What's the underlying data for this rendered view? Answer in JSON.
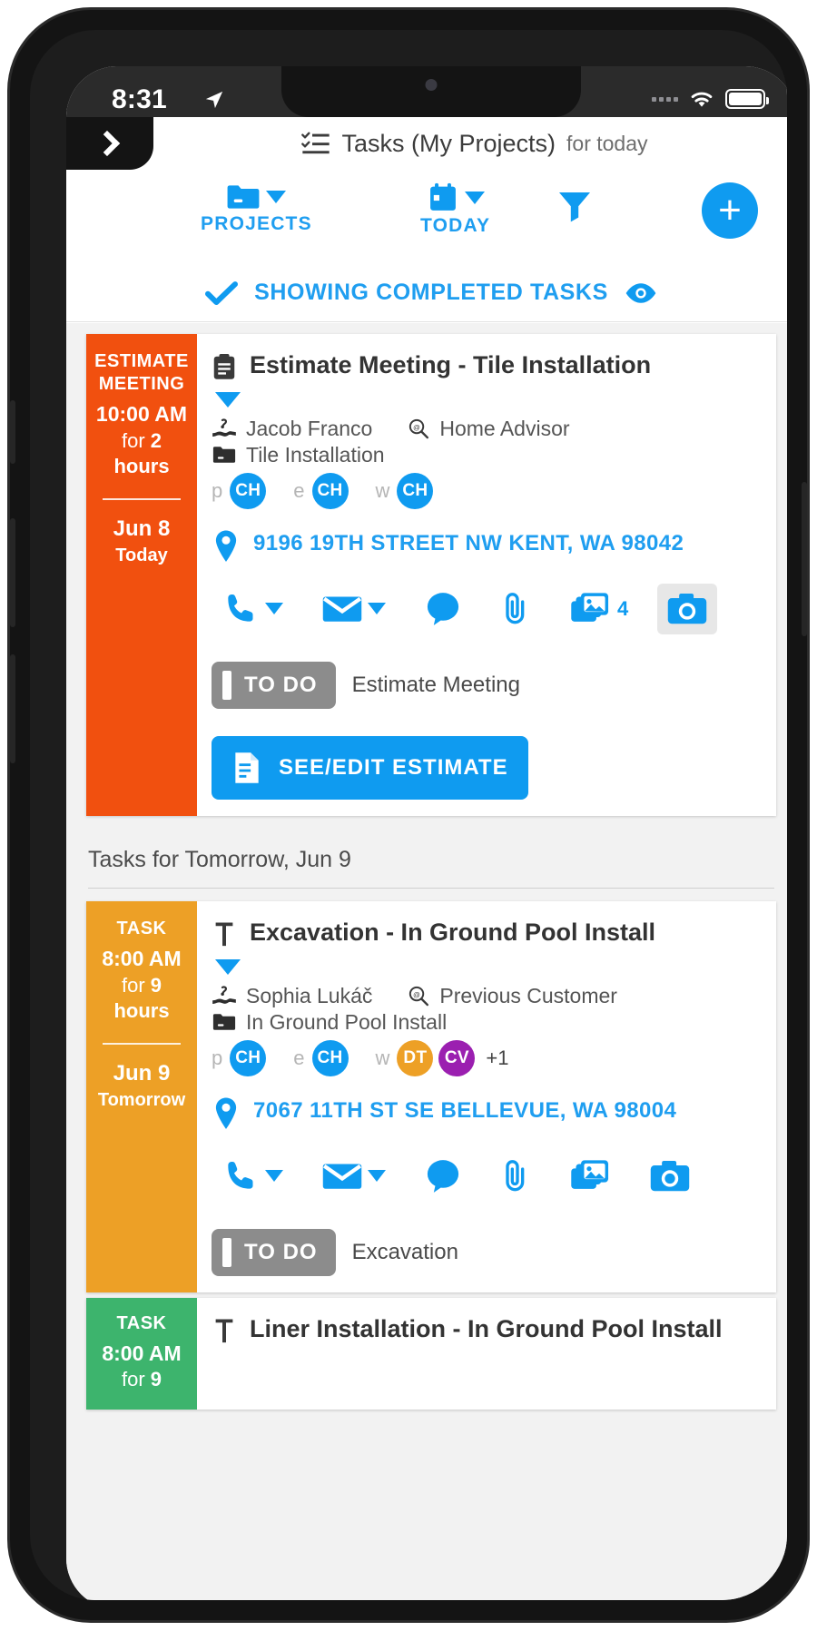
{
  "status_bar": {
    "time": "8:31",
    "location_icon": "location-arrow-icon",
    "wifi_icon": "wifi-icon",
    "battery_icon": "battery-icon"
  },
  "header": {
    "back_icon": "chevron-right-icon",
    "list_icon": "task-list-icon",
    "title": "Tasks (My Projects)",
    "subtitle": "for today"
  },
  "toolbar": {
    "projects": {
      "label": "PROJECTS",
      "icon": "folder-icon",
      "caret": "chevron-down-icon"
    },
    "today": {
      "label": "TODAY",
      "icon": "calendar-icon",
      "caret": "chevron-down-icon"
    },
    "filter": {
      "icon": "filter-icon"
    },
    "add": {
      "icon": "plus-icon",
      "label": "+"
    }
  },
  "completed_bar": {
    "check_icon": "check-icon",
    "label": "SHOWING COMPLETED TASKS",
    "eye_icon": "eye-icon"
  },
  "sections": [
    {
      "divider": null,
      "cards": [
        {
          "accent": "#f1500f",
          "kind": "ESTIMATE MEETING",
          "time": "10:00 AM",
          "duration_prefix": "for ",
          "duration_value": "2",
          "duration_unit": "hours",
          "date": "Jun 8",
          "relative": "Today",
          "title_icon": "clipboard-icon",
          "title": "Estimate Meeting - Tile Installation",
          "expand_icon": "chevron-down-icon",
          "contact_icon": "handshake-icon",
          "contact": "Jacob Franco",
          "source_icon": "magnifier-icon",
          "source": "Home Advisor",
          "project_icon": "folder-icon",
          "project": "Tile Installation",
          "avatars": [
            {
              "key": "p",
              "initials": "CH",
              "color": "#0f9bf0"
            },
            {
              "key": "e",
              "initials": "CH",
              "color": "#0f9bf0"
            },
            {
              "key": "w",
              "initials": "CH",
              "color": "#0f9bf0"
            }
          ],
          "overflow": "",
          "address_icon": "map-pin-icon",
          "address": "9196 19TH STREET NW KENT, WA 98042",
          "actions": [
            {
              "icon": "phone-icon",
              "caret": true,
              "badge": "",
              "highlight": false
            },
            {
              "icon": "envelope-icon",
              "caret": true,
              "badge": "",
              "highlight": false
            },
            {
              "icon": "chat-bubble-icon",
              "caret": false,
              "badge": "",
              "highlight": false
            },
            {
              "icon": "paperclip-icon",
              "caret": false,
              "badge": "",
              "highlight": false
            },
            {
              "icon": "photos-icon",
              "caret": false,
              "badge": "4",
              "highlight": false
            },
            {
              "icon": "camera-icon",
              "caret": false,
              "badge": "",
              "highlight": true
            }
          ],
          "status_label": "TO DO",
          "status_task": "Estimate Meeting",
          "primary_button": {
            "icon": "document-icon",
            "label": "SEE/EDIT ESTIMATE"
          }
        }
      ]
    },
    {
      "divider": "Tasks for Tomorrow, Jun 9",
      "cards": [
        {
          "accent": "#eda026",
          "kind": "TASK",
          "time": "8:00 AM",
          "duration_prefix": "for ",
          "duration_value": "9",
          "duration_unit": "hours",
          "date": "Jun 9",
          "relative": "Tomorrow",
          "title_icon": "hammer-icon",
          "title": "Excavation - In Ground Pool Install",
          "expand_icon": "chevron-down-icon",
          "contact_icon": "handshake-icon",
          "contact": "Sophia Lukáč",
          "source_icon": "magnifier-icon",
          "source": "Previous Customer",
          "project_icon": "folder-icon",
          "project": "In Ground Pool Install",
          "avatars": [
            {
              "key": "p",
              "initials": "CH",
              "color": "#0f9bf0"
            },
            {
              "key": "e",
              "initials": "CH",
              "color": "#0f9bf0"
            },
            {
              "key": "w",
              "initials": "DT",
              "color": "#eda026"
            },
            {
              "key": "",
              "initials": "CV",
              "color": "#9b1fb0"
            }
          ],
          "overflow": "+1",
          "address_icon": "map-pin-icon",
          "address": "7067 11TH ST SE BELLEVUE, WA 98004",
          "actions": [
            {
              "icon": "phone-icon",
              "caret": true,
              "badge": "",
              "highlight": false
            },
            {
              "icon": "envelope-icon",
              "caret": true,
              "badge": "",
              "highlight": false
            },
            {
              "icon": "chat-bubble-icon",
              "caret": false,
              "badge": "",
              "highlight": false
            },
            {
              "icon": "paperclip-icon",
              "caret": false,
              "badge": "",
              "highlight": false
            },
            {
              "icon": "photos-icon",
              "caret": false,
              "badge": "",
              "highlight": false
            },
            {
              "icon": "camera-icon",
              "caret": false,
              "badge": "",
              "highlight": false
            }
          ],
          "status_label": "TO DO",
          "status_task": "Excavation",
          "primary_button": null
        },
        {
          "accent": "#3db46d",
          "kind": "TASK",
          "time": "8:00 AM",
          "duration_prefix": "for ",
          "duration_value": "9",
          "duration_unit": "",
          "date": "",
          "relative": "",
          "title_icon": "hammer-icon",
          "title": "Liner Installation - In Ground Pool Install",
          "expand_icon": "",
          "contact_icon": "",
          "contact": "",
          "source_icon": "",
          "source": "",
          "project_icon": "",
          "project": "",
          "avatars": [],
          "overflow": "",
          "address_icon": "",
          "address": "",
          "actions": [],
          "status_label": "",
          "status_task": "",
          "primary_button": null
        }
      ]
    }
  ]
}
